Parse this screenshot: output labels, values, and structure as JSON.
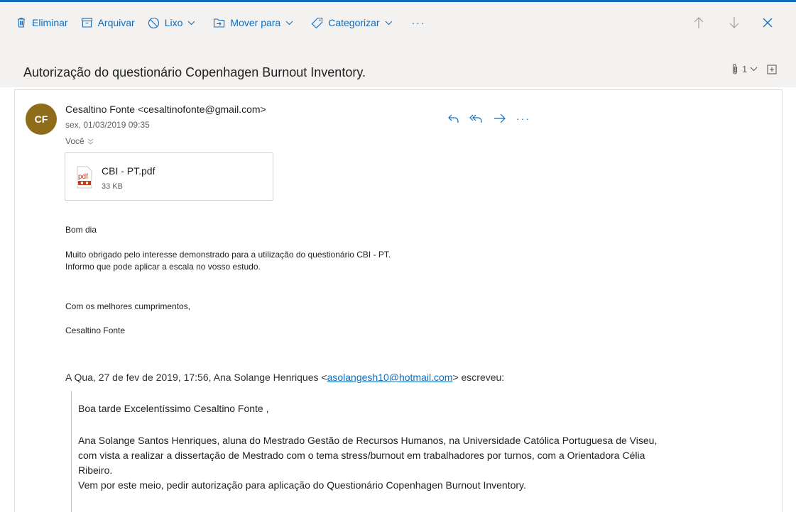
{
  "toolbar": {
    "delete_label": "Eliminar",
    "archive_label": "Arquivar",
    "junk_label": "Lixo",
    "move_label": "Mover para",
    "categorize_label": "Categorizar",
    "more_label": "···"
  },
  "message": {
    "subject": "Autorização do questionário Copenhagen Burnout Inventory.",
    "attachment_count": "1",
    "sender": {
      "initials": "CF",
      "display": "Cesaltino Fonte <cesaltinofonte@gmail.com>",
      "avatar_color": "#8e6c19"
    },
    "date": "sex, 01/03/2019 09:35",
    "to": "Você",
    "more_label": "···",
    "attachment": {
      "name": "CBI - PT.pdf",
      "size": "33 KB",
      "icon": "pdf-icon"
    },
    "body": {
      "greeting": "Bom dia",
      "line1": "Muito obrigado pelo interesse demonstrado para a utilização do questionário CBI - PT.",
      "line2": "Informo que pode aplicar a escala no vosso estudo.",
      "closing": "Com os melhores cumprimentos,",
      "signature": "Cesaltino Fonte"
    },
    "quote": {
      "header_prefix": "A Qua, 27 de fev de 2019, 17:56, Ana Solange Henriques <",
      "header_email": "asolangesh10@hotmail.com",
      "header_suffix": "> escreveu:",
      "greeting": "Boa tarde Excelentíssimo Cesaltino Fonte ,",
      "para1_line1": "Ana Solange Santos Henriques, aluna do Mestrado Gestão de Recursos Humanos, na Universidade Católica Portuguesa de Viseu,",
      "para1_line2": "com vista a realizar a dissertação de Mestrado com o tema stress/burnout em trabalhadores por turnos, com a Orientadora Célia",
      "para1_line3": "Ribeiro.",
      "para1_line4": "Vem por este meio, pedir autorização para aplicação do Questionário Copenhagen Burnout Inventory."
    }
  },
  "colors": {
    "accent": "#0f6cbd",
    "toolbar_bg": "#f3f2f1",
    "pdf_red": "#c43e1c"
  }
}
